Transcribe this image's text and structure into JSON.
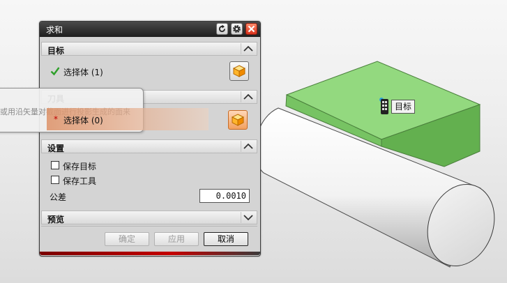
{
  "dialog": {
    "title": "求和",
    "sections": {
      "target": {
        "label": "目标",
        "select_label": "选择体 (1)"
      },
      "tool": {
        "label": "刀具",
        "select_label": "选择体 (0)",
        "required_mark": "*"
      },
      "settings": {
        "label": "设置",
        "keep_target_label": "保存目标",
        "keep_tool_label": "保存工具",
        "tolerance_label": "公差",
        "tolerance_value": "0.0010"
      },
      "preview": {
        "label": "预览"
      }
    },
    "buttons": {
      "ok": "确定",
      "apply": "应用",
      "cancel": "取消"
    }
  },
  "tooltip": {
    "text": "或用沿矢量对截面进行投影生成的面来"
  },
  "viewport": {
    "target_label": "目标"
  },
  "colors": {
    "green_body": "#8ed47a",
    "selection_orange": "#f0a060",
    "title_bar": "#2a2a2a",
    "close_red": "#d8301a"
  },
  "icons": [
    "reset-icon",
    "gear-icon",
    "close-icon",
    "chevron-up-icon",
    "chevron-down-icon",
    "solid-cube-icon",
    "checkmark-icon"
  ]
}
